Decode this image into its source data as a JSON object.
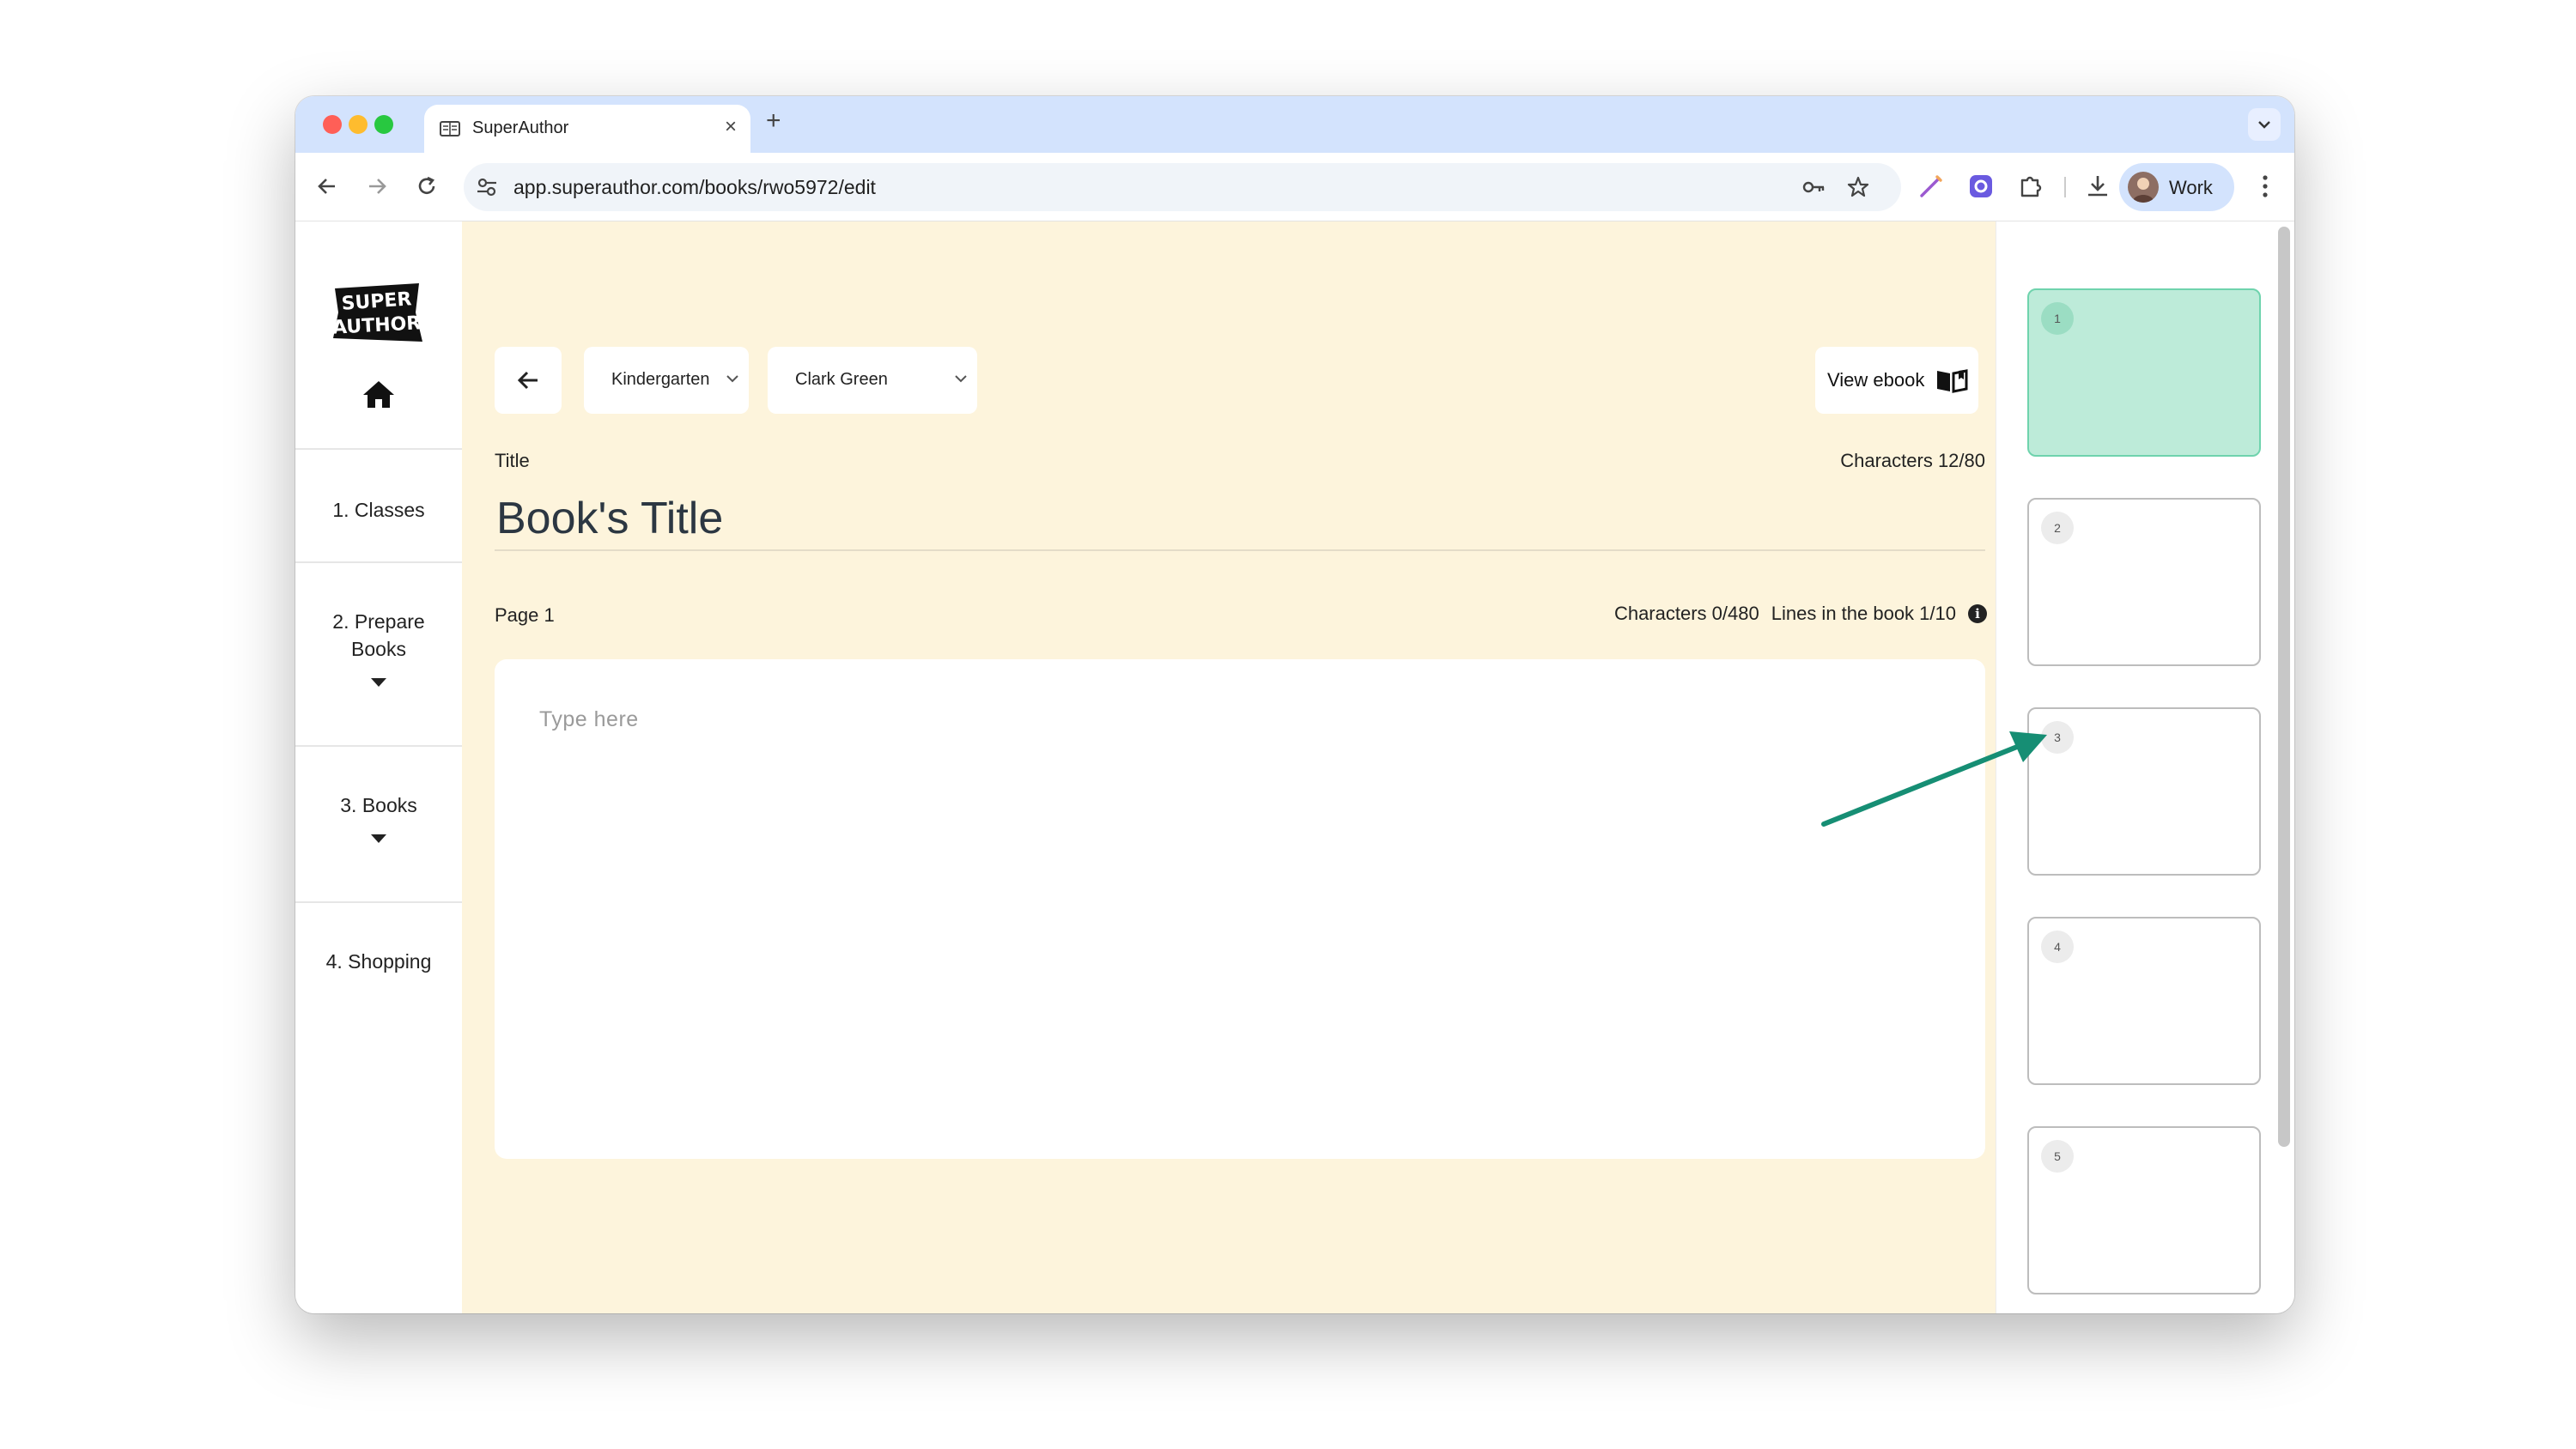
{
  "browser": {
    "tab_title": "SuperAuthor",
    "url": "app.superauthor.com/books/rwo5972/edit",
    "profile_label": "Work"
  },
  "sidebar": {
    "logo_text": "SUPER AUTHOR",
    "items": [
      {
        "label": "1. Classes"
      },
      {
        "label": "2. Prepare Books"
      },
      {
        "label": "3. Books"
      },
      {
        "label": "4. Shopping"
      }
    ]
  },
  "editor": {
    "class_select": "Kindergarten",
    "student_select": "Clark Green",
    "view_ebook_label": "View ebook",
    "title_label": "Title",
    "title_char_count": "Characters 12/80",
    "title_value": "Book's Title",
    "page_label": "Page 1",
    "page_char_count": "Characters 0/480",
    "lines_count": "Lines in the book 1/10",
    "textarea_placeholder": "Type here"
  },
  "pages": [
    {
      "number": "1",
      "active": true
    },
    {
      "number": "2",
      "active": false
    },
    {
      "number": "3",
      "active": false
    },
    {
      "number": "4",
      "active": false
    },
    {
      "number": "5",
      "active": false
    }
  ],
  "colors": {
    "editor_bg": "#fdf4dc",
    "active_page": "#bdebd9",
    "annotation_arrow": "#168e74"
  }
}
